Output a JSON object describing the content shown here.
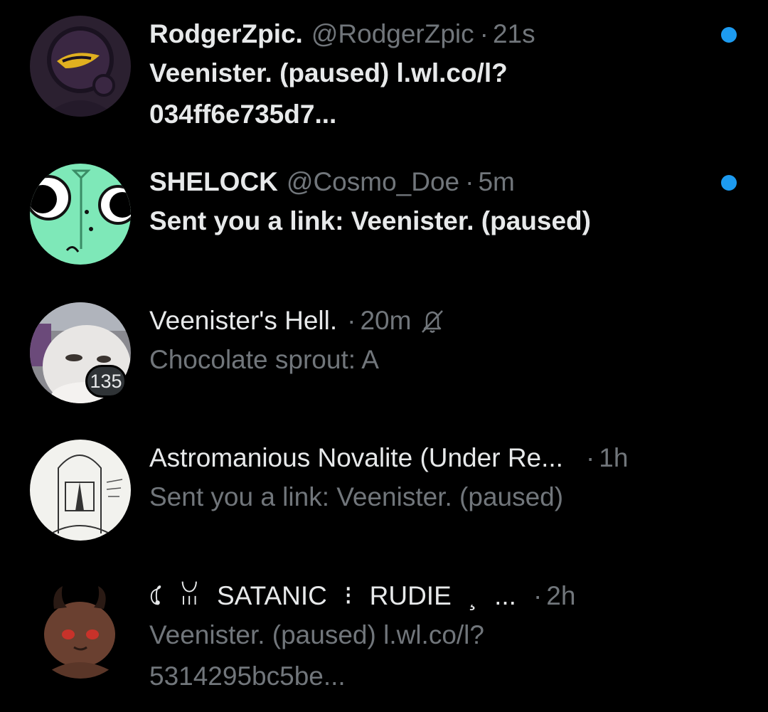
{
  "conversations": [
    {
      "display_name": "RodgerZpic.",
      "handle": "@RodgerZpic",
      "separator": "·",
      "time": "21s",
      "preview": "Veenister. (paused) l.wl.co/l? 034ff6e735d7...",
      "unread": true,
      "avatar_icon": "purple-figure-avatar"
    },
    {
      "display_name": "SHELOCK",
      "handle": "@Cosmo_Doe",
      "separator": "·",
      "time": "5m",
      "preview": "Sent you a link: Veenister. (paused)",
      "unread": true,
      "avatar_icon": "green-eyes-avatar"
    },
    {
      "display_name": "Veenister's Hell.",
      "separator": "·",
      "time": "20m",
      "preview": "Chocolate sprout: A",
      "unread": false,
      "muted": true,
      "badge_count": "135",
      "avatar_icon": "cat-photo-avatar"
    },
    {
      "display_name": "Astromanious Novalite (Under Re...",
      "separator": "·",
      "time": "1h",
      "preview": "Sent you a link: Veenister. (paused)",
      "unread": false,
      "avatar_icon": "sketch-helmet-avatar"
    },
    {
      "display_name_parts": [
        "𖤃",
        "ꈍ",
        "SATANIC",
        "⁝",
        "RUDIE",
        "¸",
        "..."
      ],
      "separator": "·",
      "time": "2h",
      "preview": "Veenister. (paused) l.wl.co/l? 5314295bc5be...",
      "unread": false,
      "avatar_icon": "horned-creature-avatar"
    }
  ],
  "colors": {
    "background": "#000000",
    "primary_text": "#e7e9ea",
    "secondary_text": "#71767b",
    "unread_dot": "#1d9bf0",
    "badge_bg": "#2f3336"
  }
}
